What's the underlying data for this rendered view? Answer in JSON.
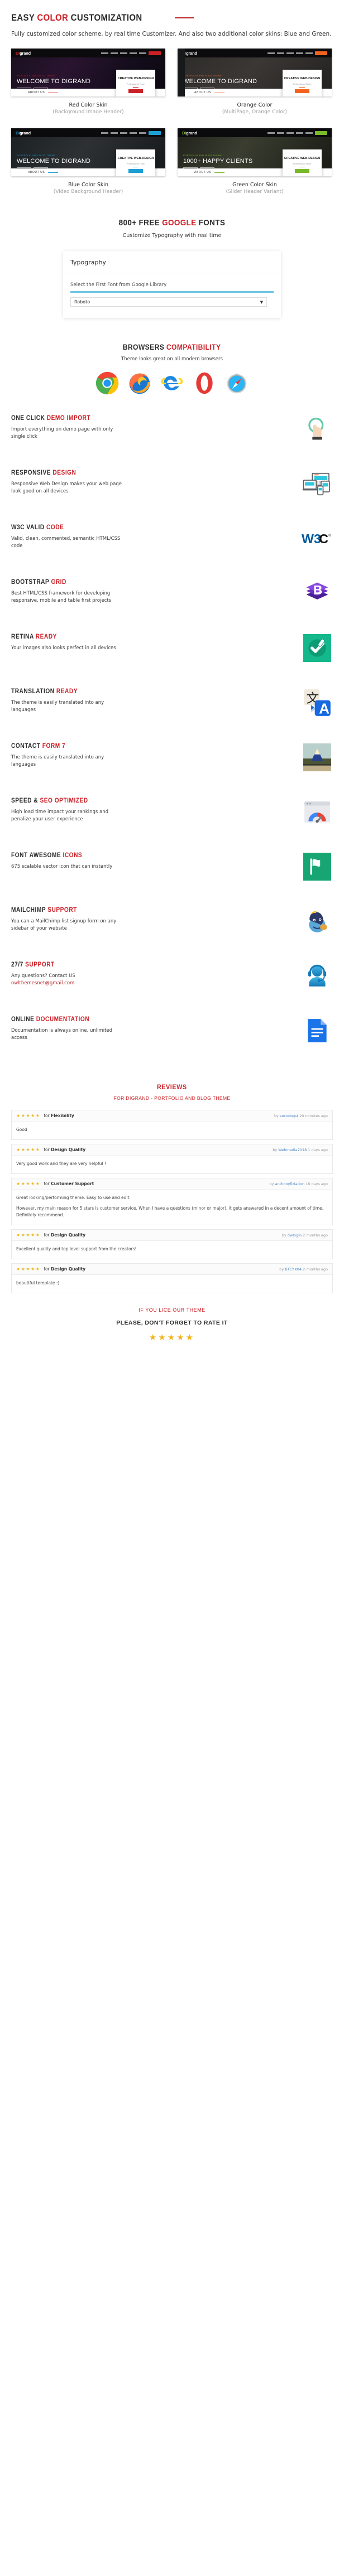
{
  "color_section": {
    "title_part1": "EASY ",
    "title_accent": "COLOR",
    "title_part2": " CUSTOMIZATION",
    "lead": "Fully customized color scheme, by real time Customizer. And also two additional color skins: Blue and Green.",
    "skins": [
      {
        "name": "Red Color Skin",
        "variant": "(Background Image Header)",
        "accent": "#cc2027",
        "logo_mark": "DI",
        "logo_word": "grand",
        "logo_sub": "CREATIVE AGENCY",
        "hero_kicker": "PORTFOLIO AND BLOG THEME",
        "hero_title": "WELCOME TO DIGRAND",
        "hero_btn1": "OUR WORKS",
        "hero_btn2": "ABOUT US",
        "card_title": "CREATIVE WEB-DESIGN",
        "card_sub": "Professional Team",
        "card_btn": "VIEW MORE",
        "about_label": "ABOUT US",
        "nav_btn": "BUY NOW",
        "has_rail": false,
        "hero_bg": "desk"
      },
      {
        "name": "Orange Color",
        "variant": "(MultiPage, Orange Color)",
        "accent": "#f4631e",
        "logo_mark": "DI",
        "logo_word": "grand",
        "logo_sub": "CREATIVE AGENCY",
        "hero_kicker": "PORTFOLIO AND BLOG THEME",
        "hero_title": "WELCOME TO DIGRAND",
        "hero_btn1": "OUR WORKS",
        "hero_btn2": "ABOUT US",
        "card_title": "CREATIVE WEB-DESIGN",
        "card_sub": "Professional Team",
        "card_btn": "VIEW MORE",
        "about_label": "ABOUT US",
        "nav_btn": "BUY NOW",
        "has_rail": true,
        "hero_bg": "flatlay"
      },
      {
        "name": "Blue Color Skin",
        "variant": "(Video Background Header)",
        "accent": "#1e9fd4",
        "logo_mark": "DI",
        "logo_word": "grand",
        "logo_sub": "CREATIVE AGENCY",
        "hero_kicker": "PORTFOLIO AND BLOG THEME",
        "hero_title": "WELCOME TO DIGRAND",
        "hero_btn1": "OUR WORKS",
        "hero_btn2": "ABOUT US",
        "card_title": "CREATIVE WEB-DESIGN",
        "card_sub": "Professional Team",
        "card_btn": "VIEW MORE",
        "about_label": "ABOUT US",
        "nav_btn": "BUY NOW",
        "has_rail": false,
        "hero_bg": "office"
      },
      {
        "name": "Green Color Skin",
        "variant": "(Slider Header Variant)",
        "accent": "#7ab929",
        "logo_mark": "DI",
        "logo_word": "grand",
        "logo_sub": "CREATIVE AGENCY",
        "hero_kicker": "PORTFOLIO AND BLOG THEME",
        "hero_title": "1000+ HAPPY CLIENTS",
        "hero_btn1": "WORKS",
        "hero_btn2": "ABOUT",
        "card_title": "CREATIVE WEB-DESIGN",
        "card_sub": "Professional Team",
        "card_btn": "VIEW MORE",
        "about_label": "ABOUT US",
        "nav_btn": "BUY NOW",
        "has_rail": false,
        "hero_bg": "laptop"
      }
    ]
  },
  "fonts_section": {
    "title_part1": "800+ FREE ",
    "title_accent": "GOOGLE",
    "title_part2": " FONTS",
    "subtitle": "Customize Typography with real time",
    "panel_title": "Typography",
    "field_label": "Select the First Font from Google Library",
    "select_value": "Roboto",
    "caret": "▼"
  },
  "browsers_section": {
    "title_part1": "BROWSERS ",
    "title_accent": "COMPATIBILITY",
    "subtitle": "Theme  looks great on all modern browsers",
    "icons": [
      "chrome-icon",
      "firefox-icon",
      "internet-explorer-icon",
      "opera-icon",
      "safari-icon"
    ]
  },
  "features": [
    {
      "title_part1": "ONE CLICK ",
      "title_accent": "DEMO IMPORT",
      "desc": "Import everything on demo page with only single click",
      "icon": "one-click-demo-import-icon"
    },
    {
      "title_part1": "RESPONSIVE ",
      "title_accent": "DESIGN",
      "desc": "Responsive Web Design makes your web page look good on all devices",
      "icon": "responsive-devices-icon"
    },
    {
      "title_part1": "W3C VALID ",
      "title_accent": "CODE",
      "desc": "Valid, clean, commented, semantic HTML/CSS code",
      "icon": "w3c-logo-icon"
    },
    {
      "title_part1": "BOOTSTRAP ",
      "title_accent": "GRID",
      "desc": "Best HTML/CSS framework for developing responsive, mobile and table first projects",
      "icon": "bootstrap-logo-icon"
    },
    {
      "title_part1": "RETINA ",
      "title_accent": "READY",
      "desc": "Your images also looks perfect in all devices",
      "icon": "retina-check-icon"
    },
    {
      "title_part1": "TRANSLATION ",
      "title_accent": "READY",
      "desc": "The theme is easily translated into any languages",
      "icon": "google-translate-icon"
    },
    {
      "title_part1": "CONTACT ",
      "title_accent": "FORM 7",
      "desc": "The theme is easily translated into any languages",
      "icon": "contact-form-7-icon"
    },
    {
      "title_part1": "SPEED & ",
      "title_accent": "SEO OPTIMIZED",
      "desc": "High load time impact your rankings and penalize your user experience",
      "icon": "pagespeed-gauge-icon"
    },
    {
      "title_part1": "FONT AWESOME ",
      "title_accent": "ICONS",
      "desc": "675 scalable vector icon that can instantly",
      "icon": "font-awesome-flag-icon"
    },
    {
      "title_part1": "MAILCHIMP ",
      "title_accent": "SUPPORT",
      "desc": "You can a MailChimp list signup form on any sidebar of your website",
      "icon": "mailchimp-logo-icon"
    },
    {
      "title_part1": "27/7 ",
      "title_accent": "SUPPORT",
      "desc": "Any questions? Contact US",
      "link": "owlthemesnet@gmail.com",
      "icon": "support-headset-icon"
    },
    {
      "title_part1": "ONLINE ",
      "title_accent": "DOCUMENTATION",
      "desc": "Documentation is always online, unlimited access",
      "icon": "documentation-file-icon"
    }
  ],
  "reviews_section": {
    "title": "REVIEWS",
    "subtitle": "FOR DIGRAND - PORTFOLIO AND BLOG THEME",
    "stars": "★★★★★",
    "for_word": "for",
    "by_word": "by",
    "items": [
      {
        "stars": "★★★★★",
        "topic": "Flexibility",
        "author": "socodogst",
        "time": "20 minutes ago",
        "body": [
          "Good"
        ]
      },
      {
        "stars": "★★★★★",
        "topic": "Design Quality",
        "author": "Webmedia2018",
        "time": "1 days ago",
        "body": [
          "Very good work and they are very helpful !"
        ]
      },
      {
        "stars": "★★★★★",
        "topic": "Customer Support",
        "author": "anthonyfiziation",
        "time": "16 days ago",
        "body": [
          "Great looking/performing theme. Easy to use and edit.",
          "However, my main reason for 5 stars is customer service. When I have a questions (minor or major), it gets answered in a decent amount of time. Definitely recommend."
        ]
      },
      {
        "stars": "★★★★★",
        "topic": "Design Quality",
        "author": "dwlogin",
        "time": "2 months ago",
        "body": [
          "Excellent quality and top level support from the creators!"
        ]
      },
      {
        "stars": "★★★★★",
        "topic": "Design Quality",
        "author": "BTCY.K04",
        "time": "2 months ago",
        "body": [
          "beautiful template :)"
        ]
      }
    ]
  },
  "footer": {
    "line1": "IF YOU LICE OUR THEME",
    "line2": "PLEASE, DON'T FORGET TO RATE IT",
    "stars": "★★★★★"
  }
}
